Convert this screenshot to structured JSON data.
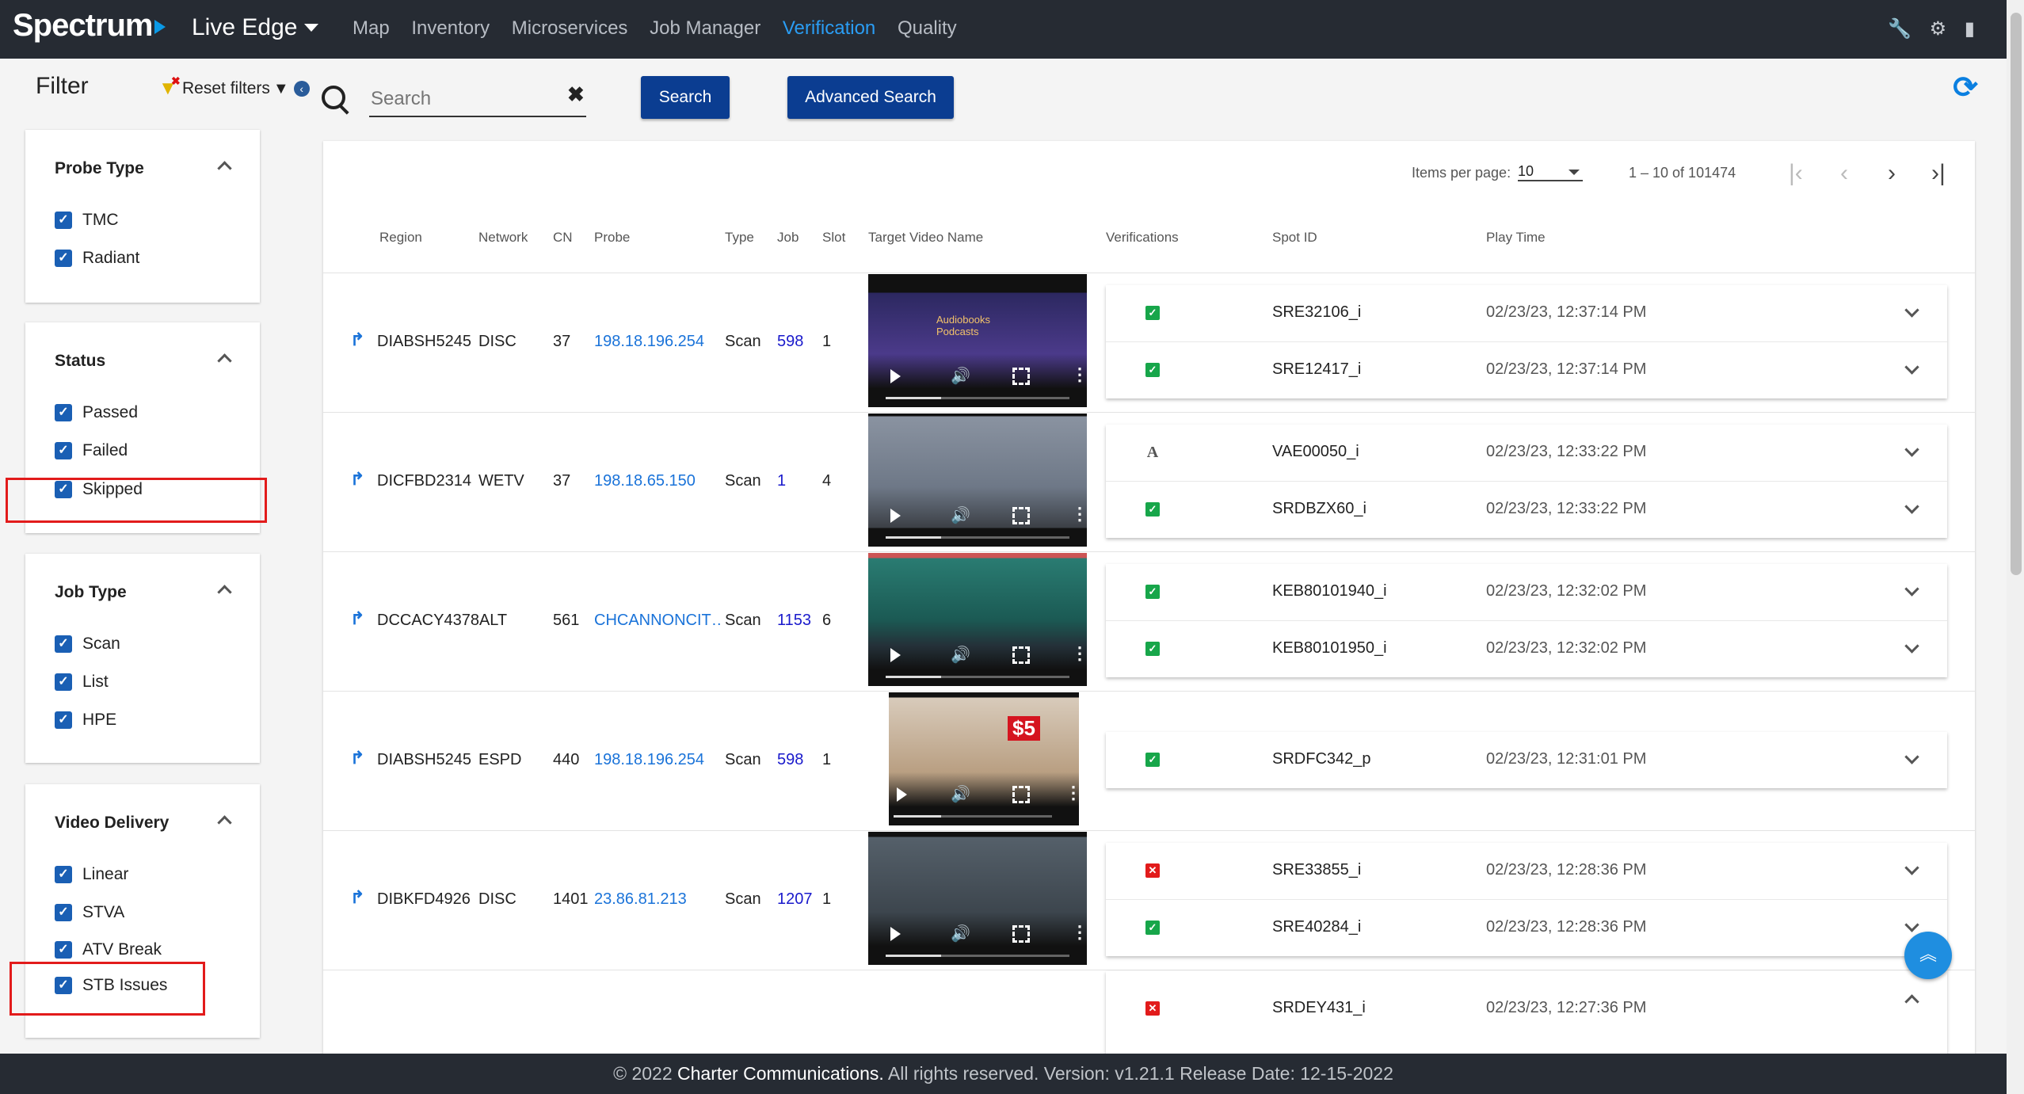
{
  "header": {
    "logo": "Spectrum",
    "app_title": "Live Edge",
    "nav": [
      "Map",
      "Inventory",
      "Microservices",
      "Job Manager",
      "Verification",
      "Quality"
    ],
    "active_nav": "Verification",
    "icons": [
      "wrench-icon",
      "gear-icon",
      "book-icon"
    ]
  },
  "filter": {
    "title": "Filter",
    "reset_label": "Reset filters",
    "groups": [
      {
        "title": "Probe Type",
        "items": [
          "TMC",
          "Radiant"
        ]
      },
      {
        "title": "Status",
        "items": [
          "Passed",
          "Failed",
          "Skipped"
        ]
      },
      {
        "title": "Job Type",
        "items": [
          "Scan",
          "List",
          "HPE"
        ]
      },
      {
        "title": "Video Delivery",
        "items": [
          "Linear",
          "STVA",
          "ATV Break",
          "STB Issues"
        ]
      }
    ]
  },
  "search": {
    "placeholder": "Search",
    "search_button": "Search",
    "advanced_button": "Advanced Search"
  },
  "pager": {
    "items_per_page_label": "Items per page:",
    "items_per_page": "10",
    "range": "1 – 10 of 101474"
  },
  "table": {
    "columns": [
      "Region",
      "Network",
      "CN",
      "Probe",
      "Type",
      "Job",
      "Slot",
      "Target Video Name",
      "Verifications",
      "Spot ID",
      "Play Time"
    ],
    "rows": [
      {
        "region": "DIABSH5245",
        "network": "DISC",
        "cn": "37",
        "probe": "198.18.196.254",
        "type": "Scan",
        "job": "598",
        "slot": "1",
        "verifications": [
          {
            "status": "ok",
            "spot": "SRE32106_i",
            "time": "02/23/23, 12:37:14 PM"
          },
          {
            "status": "ok",
            "spot": "SRE12417_i",
            "time": "02/23/23, 12:37:14 PM"
          }
        ]
      },
      {
        "region": "DICFBD2314",
        "network": "WETV",
        "cn": "37",
        "probe": "198.18.65.150",
        "type": "Scan",
        "job": "1",
        "slot": "4",
        "verifications": [
          {
            "status": "text",
            "spot": "VAE00050_i",
            "time": "02/23/23, 12:33:22 PM"
          },
          {
            "status": "ok",
            "spot": "SRDBZX60_i",
            "time": "02/23/23, 12:33:22 PM"
          }
        ]
      },
      {
        "region": "DCCACY4378ALT",
        "network": "",
        "cn": "561",
        "probe": "CHCANNONCIT…",
        "type": "Scan",
        "job": "1153",
        "slot": "6",
        "verifications": [
          {
            "status": "ok",
            "spot": "KEB80101940_i",
            "time": "02/23/23, 12:32:02 PM"
          },
          {
            "status": "ok",
            "spot": "KEB80101950_i",
            "time": "02/23/23, 12:32:02 PM"
          }
        ]
      },
      {
        "region": "DIABSH5245",
        "network": "ESPD",
        "cn": "440",
        "probe": "198.18.196.254",
        "type": "Scan",
        "job": "598",
        "slot": "1",
        "verifications": [
          {
            "status": "ok",
            "spot": "SRDFC342_p",
            "time": "02/23/23, 12:31:01 PM"
          }
        ]
      },
      {
        "region": "DIBKFD4926",
        "network": "DISC",
        "cn": "1401",
        "probe": "23.86.81.213",
        "type": "Scan",
        "job": "1207",
        "slot": "1",
        "verifications": [
          {
            "status": "fail",
            "spot": "SRE33855_i",
            "time": "02/23/23, 12:28:36 PM"
          },
          {
            "status": "ok",
            "spot": "SRE40284_i",
            "time": "02/23/23, 12:28:36 PM"
          }
        ]
      }
    ],
    "partial_row": {
      "status": "fail",
      "spot": "SRDEY431_i",
      "time": "02/23/23, 12:27:36 PM"
    }
  },
  "thumbs": [
    {
      "overlay": "Audiobooks\nPodcasts",
      "bg": "#2c2860"
    },
    {
      "overlay": "",
      "bg": "#7d8796"
    },
    {
      "overlay": "",
      "bg": "#1d6b63"
    },
    {
      "overlay": "$5",
      "bg": "#c9b9a8"
    },
    {
      "overlay": "",
      "bg": "#4a5259"
    }
  ],
  "footer": {
    "copyright": "© 2022 ",
    "company": "Charter Communications.",
    "rest": " All rights reserved. Version: v1.21.1 Release Date: 12-15-2022"
  },
  "colors": {
    "accent": "#1a73d9",
    "header_bg": "#262b33",
    "button_bg": "#0b3d91",
    "ok": "#17a64a",
    "fail": "#e21b1b"
  }
}
